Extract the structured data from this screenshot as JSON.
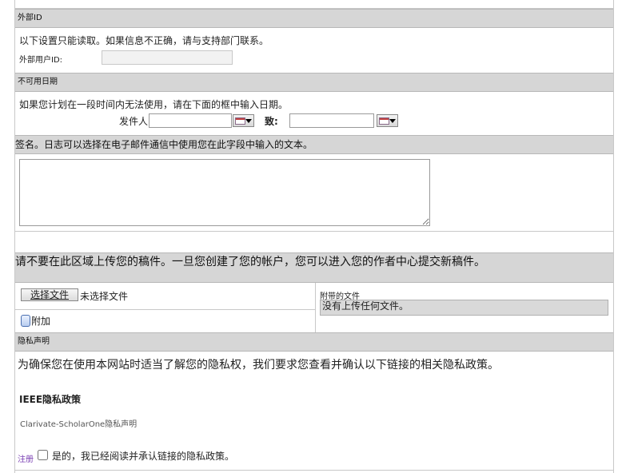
{
  "external_id": {
    "header": "外部ID",
    "notice": "以下设置只能读取。如果信息不正确，请与支持部门联系。",
    "user_id_label": "外部用户ID:",
    "user_id_value": ""
  },
  "unavailable_dates": {
    "header": "不可用日期",
    "instruction": "如果您计划在一段时间内无法使用，请在下面的框中输入日期。",
    "from_label": "发件人:",
    "from_value": "",
    "to_label": "致:",
    "to_value": ""
  },
  "signature": {
    "header": "签名。日志可以选择在电子邮件通信中使用您在此字段中输入的文本。",
    "value": ""
  },
  "upload": {
    "warning": "请不要在此区域上传您的稿件。一旦您创建了您的帐户，您可以进入您的作者中心提交新稿件。",
    "choose_file_button": "选择文件",
    "no_file_chosen": "未选择文件",
    "attach_label": "附加",
    "attached_files_header": "附带的文件",
    "attached_files_value": "没有上传任何文件。"
  },
  "privacy": {
    "header": "隐私声明",
    "intro": "为确保您在使用本网站时适当了解您的隐私权，我们要求您查看并确认以下链接的相关隐私政策。",
    "ieee_policy_link": "IEEE隐私政策",
    "clarivate_policy_link": "Clarivate-ScholarOne隐私声明",
    "required_marker": "注册",
    "ack_label": "是的，我已经阅读并承认链接的隐私政策。"
  },
  "colors": {
    "header_bg": "#d6d6d6",
    "required_marker": "#7a3fb3",
    "link": "#555555"
  }
}
